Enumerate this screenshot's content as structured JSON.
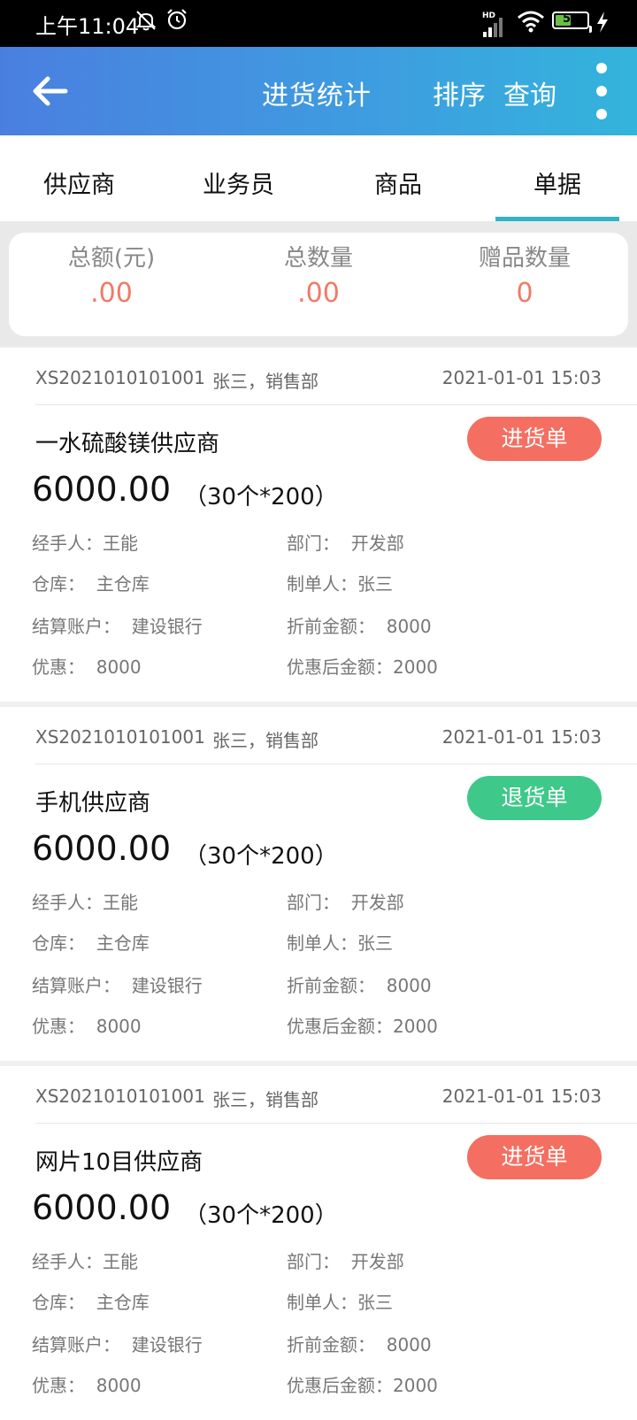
{
  "status_bar": {
    "time": "上午11:04",
    "hd": "HD",
    "battery_level": "50",
    "battery_fraction": 0.5
  },
  "header": {
    "title": "进货统计",
    "sort_label": "排序",
    "query_label": "查询",
    "back_icon": "arrow-left-icon",
    "more_icon": "more-vertical-icon"
  },
  "tabs": [
    {
      "label": "供应商"
    },
    {
      "label": "业务员"
    },
    {
      "label": "商品"
    },
    {
      "label": "单据",
      "active": true
    }
  ],
  "summary": [
    {
      "label": "总额(元)",
      "value": ".00"
    },
    {
      "label": "总数量",
      "value": ".00"
    },
    {
      "label": "赠品数量",
      "value": "0"
    }
  ],
  "colors": {
    "header_gradient_start": "#4a7fe0",
    "header_gradient_end": "#33b4dc",
    "tab_indicator": "#33b4c4",
    "summary_value": "#f07a68",
    "badge_purchase": "#f46f61",
    "badge_return": "#3ec98a"
  },
  "cards": [
    {
      "order_no": "XS2021010101001",
      "user": "张三，销售部",
      "date": "2021-01-01 15:03",
      "supplier": "一水硫酸镁供应商",
      "badge": "进货单",
      "badge_type": "purchase",
      "amount": "6000.00",
      "qty": "（30个*200）",
      "handler": "经手人：王能",
      "dept": "部门：  开发部",
      "warehouse": "仓库：  主仓库",
      "creator": "制单人：张三",
      "account": "结算账户：  建设银行",
      "pre_discount": "折前金额：  8000",
      "discount": "优惠：  8000",
      "post_discount": "优惠后金额：2000"
    },
    {
      "order_no": "XS2021010101001",
      "user": "张三，销售部",
      "date": "2021-01-01 15:03",
      "supplier": "手机供应商",
      "badge": "退货单",
      "badge_type": "return",
      "amount": "6000.00",
      "qty": "（30个*200）",
      "handler": "经手人：王能",
      "dept": "部门：  开发部",
      "warehouse": "仓库：  主仓库",
      "creator": "制单人：张三",
      "account": "结算账户：  建设银行",
      "pre_discount": "折前金额：  8000",
      "discount": "优惠：  8000",
      "post_discount": "优惠后金额：2000"
    },
    {
      "order_no": "XS2021010101001",
      "user": "张三，销售部",
      "date": "2021-01-01 15:03",
      "supplier": "网片10目供应商",
      "badge": "进货单",
      "badge_type": "purchase",
      "amount": "6000.00",
      "qty": "（30个*200）",
      "handler": "经手人：王能",
      "dept": "部门：  开发部",
      "warehouse": "仓库：  主仓库",
      "creator": "制单人：张三",
      "account": "结算账户：  建设银行",
      "pre_discount": "折前金额：  8000",
      "discount": "优惠：  8000",
      "post_discount": "优惠后金额：2000"
    }
  ]
}
